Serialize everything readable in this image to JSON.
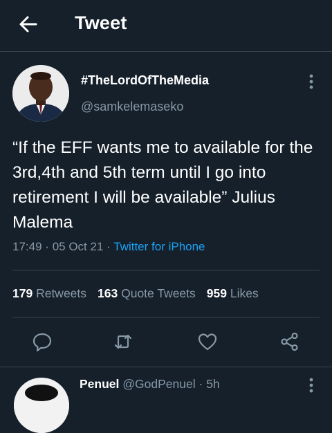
{
  "header": {
    "title": "Tweet",
    "back_icon": "arrow-left-icon"
  },
  "tweet": {
    "display_name": "#TheLordOfTheMedia",
    "handle": "@samkelemaseko",
    "text": "“If the EFF wants me to available for the 3rd,4th and 5th term until I go into retirement I will  be available” Julius Malema",
    "time": "17:49",
    "date": "05 Oct 21",
    "separator": "·",
    "source": "Twitter for iPhone",
    "more_icon": "more-vertical-icon"
  },
  "stats": {
    "retweets_count": "179",
    "retweets_label": "Retweets",
    "quotes_count": "163",
    "quotes_label": "Quote Tweets",
    "likes_count": "959",
    "likes_label": "Likes"
  },
  "actions": [
    "reply-icon",
    "retweet-icon",
    "like-icon",
    "share-icon"
  ],
  "reply": {
    "name": "Penuel",
    "handle": "@GodPenuel",
    "separator": "·",
    "time": "5h"
  },
  "colors": {
    "background": "#15202b",
    "secondary_text": "#8899a6",
    "accent": "#1da1f2",
    "divider": "#38444d"
  }
}
